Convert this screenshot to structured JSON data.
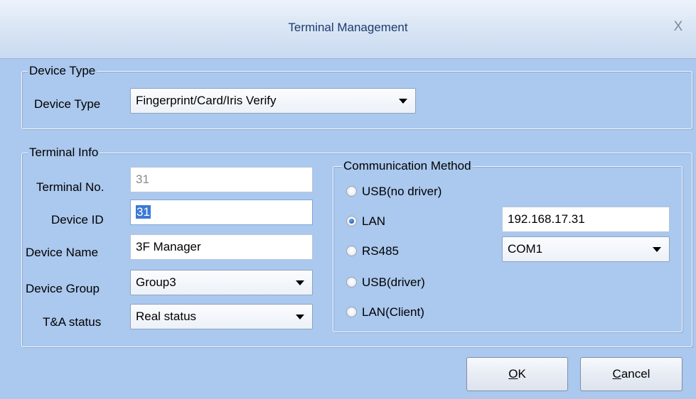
{
  "window": {
    "title": "Terminal Management",
    "close_glyph": "X"
  },
  "device_type_group": {
    "legend": "Device Type",
    "label": "Device Type",
    "value": "Fingerprint/Card/Iris Verify"
  },
  "terminal_info_group": {
    "legend": "Terminal Info",
    "fields": {
      "terminal_no": {
        "label": "Terminal No.",
        "value": "31"
      },
      "device_id": {
        "label": "Device ID",
        "value": "31"
      },
      "device_name": {
        "label": "Device Name",
        "value": "3F Manager"
      },
      "device_group": {
        "label": "Device Group",
        "value": "Group3"
      },
      "ta_status": {
        "label": "T&A status",
        "value": "Real status"
      }
    }
  },
  "communication": {
    "legend": "Communication Method",
    "options": [
      {
        "label": "USB(no driver)",
        "checked": false
      },
      {
        "label": "LAN",
        "checked": true
      },
      {
        "label": "RS485",
        "checked": false
      },
      {
        "label": "USB(driver)",
        "checked": false
      },
      {
        "label": "LAN(Client)",
        "checked": false
      }
    ],
    "ip_address": "192.168.17.31",
    "com_port": "COM1"
  },
  "buttons": {
    "ok_mnemonic": "O",
    "ok_rest": "K",
    "cancel_mnemonic": "C",
    "cancel_rest": "ancel"
  }
}
